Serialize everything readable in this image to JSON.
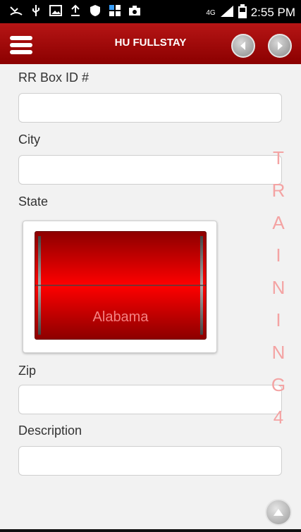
{
  "status_bar": {
    "icons": [
      "missed-call-icon",
      "usb-icon",
      "image-icon",
      "upload-icon",
      "shield-icon",
      "grid-app-icon",
      "camera-icon"
    ],
    "network": "4G",
    "time": "2:55 PM"
  },
  "app_bar": {
    "title": "HU FULLSTAY"
  },
  "form": {
    "rr_box_label": "RR Box ID #",
    "rr_box_value": "",
    "city_label": "City",
    "city_value": "",
    "state_label": "State",
    "state_selected": "Alabama",
    "zip_label": "Zip",
    "zip_value": "",
    "description_label": "Description",
    "description_value": ""
  },
  "watermark": {
    "letters": [
      "T",
      "R",
      "A",
      "I",
      "N",
      "I",
      "N",
      "G",
      "4"
    ]
  },
  "colors": {
    "accent": "#b61515",
    "picker_red": "#ff0000",
    "watermark": "#f4a3a3"
  }
}
